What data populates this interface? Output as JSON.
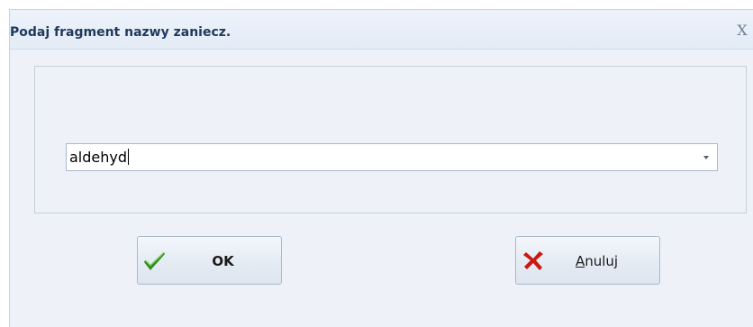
{
  "dialog": {
    "title": "Podaj fragment nazwy zaniecz.",
    "close_glyph": "X"
  },
  "combo": {
    "value": "aldehyd",
    "dropdown_icon": "chevron-down-icon"
  },
  "buttons": {
    "ok": {
      "label": "OK",
      "icon": "checkmark-icon",
      "icon_color": "#2e8b1e"
    },
    "cancel": {
      "mnemonic": "A",
      "label_rest": "nuluj",
      "icon": "cross-icon",
      "icon_color": "#c81a12"
    }
  }
}
